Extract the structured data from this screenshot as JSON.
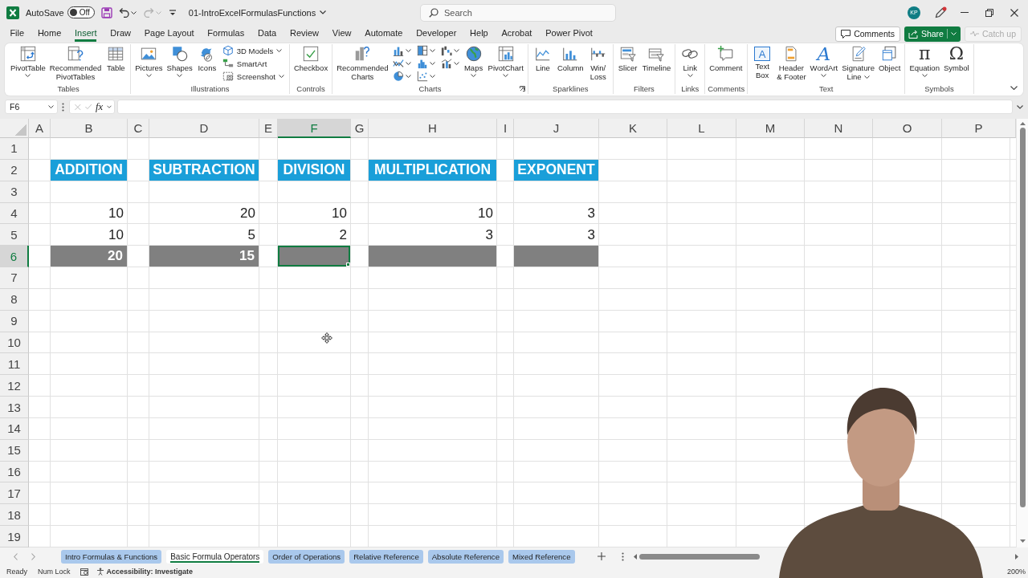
{
  "title_bar": {
    "autosave": {
      "label": "AutoSave",
      "state_text": "Off",
      "on": false
    },
    "undo": {
      "disabled": false
    },
    "redo": {
      "disabled": true
    },
    "filename": "01-IntroExcelFormulasFunctions",
    "search": {
      "placeholder": "Search"
    },
    "account_initials": "KP"
  },
  "ribbon_tabs": [
    {
      "label": "File",
      "selected": false
    },
    {
      "label": "Home",
      "selected": false
    },
    {
      "label": "Insert",
      "selected": true
    },
    {
      "label": "Draw",
      "selected": false
    },
    {
      "label": "Page Layout",
      "selected": false
    },
    {
      "label": "Formulas",
      "selected": false
    },
    {
      "label": "Data",
      "selected": false
    },
    {
      "label": "Review",
      "selected": false
    },
    {
      "label": "View",
      "selected": false
    },
    {
      "label": "Automate",
      "selected": false
    },
    {
      "label": "Developer",
      "selected": false
    },
    {
      "label": "Help",
      "selected": false
    },
    {
      "label": "Acrobat",
      "selected": false
    },
    {
      "label": "Power Pivot",
      "selected": false
    }
  ],
  "ribbon_buttons": {
    "comments": "Comments",
    "share": "Share",
    "catch_up": {
      "label": "Catch up",
      "disabled": true
    }
  },
  "ribbon_groups": [
    {
      "name": "Tables",
      "launcher": false,
      "items": [
        {
          "kind": "large",
          "label": "PivotTable",
          "dropdown": true
        },
        {
          "kind": "large",
          "label": "Recommended\nPivotTables",
          "dropdown": false
        },
        {
          "kind": "large",
          "label": "Table",
          "dropdown": false
        }
      ]
    },
    {
      "name": "Illustrations",
      "launcher": false,
      "items": [
        {
          "kind": "large",
          "label": "Pictures",
          "dropdown": true
        },
        {
          "kind": "large",
          "label": "Shapes",
          "dropdown": true
        },
        {
          "kind": "large",
          "label": "Icons",
          "dropdown": false
        },
        {
          "kind": "small",
          "label": "3D Models",
          "dropdown": true
        },
        {
          "kind": "small",
          "label": "SmartArt",
          "dropdown": false
        },
        {
          "kind": "small",
          "label": "Screenshot",
          "dropdown": true
        }
      ]
    },
    {
      "name": "Controls",
      "launcher": false,
      "items": [
        {
          "kind": "large",
          "label": "Checkbox",
          "dropdown": false
        }
      ]
    },
    {
      "name": "Charts",
      "launcher": true,
      "items": [
        {
          "kind": "large",
          "label": "Recommended\nCharts",
          "dropdown": false
        },
        {
          "kind": "icon",
          "dropdown": true
        },
        {
          "kind": "icon",
          "dropdown": true
        },
        {
          "kind": "icon",
          "dropdown": true
        },
        {
          "kind": "icon",
          "dropdown": true
        },
        {
          "kind": "icon",
          "dropdown": true
        },
        {
          "kind": "icon",
          "dropdown": true
        },
        {
          "kind": "icon",
          "dropdown": true
        },
        {
          "kind": "icon",
          "dropdown": true
        },
        {
          "kind": "large",
          "label": "Maps",
          "dropdown": true
        },
        {
          "kind": "large",
          "label": "PivotChart",
          "dropdown": true
        }
      ]
    },
    {
      "name": "Sparklines",
      "launcher": false,
      "items": [
        {
          "kind": "large",
          "label": "Line",
          "dropdown": false
        },
        {
          "kind": "large",
          "label": "Column",
          "dropdown": false
        },
        {
          "kind": "large",
          "label": "Win/\nLoss",
          "dropdown": false
        }
      ]
    },
    {
      "name": "Filters",
      "launcher": false,
      "items": [
        {
          "kind": "large",
          "label": "Slicer",
          "dropdown": false
        },
        {
          "kind": "large",
          "label": "Timeline",
          "dropdown": false
        }
      ]
    },
    {
      "name": "Links",
      "launcher": false,
      "items": [
        {
          "kind": "large",
          "label": "Link",
          "dropdown": true
        }
      ]
    },
    {
      "name": "Comments",
      "launcher": false,
      "items": [
        {
          "kind": "large",
          "label": "Comment",
          "dropdown": false
        }
      ]
    },
    {
      "name": "Text",
      "launcher": false,
      "items": [
        {
          "kind": "large",
          "glyph": "A",
          "label": "Text\nBox",
          "dropdown": false
        },
        {
          "kind": "large",
          "label": "Header\n& Footer",
          "dropdown": false
        },
        {
          "kind": "large",
          "glyph": "A",
          "label": "WordArt",
          "dropdown": true
        },
        {
          "kind": "large",
          "label": "Signature\nLine",
          "dropdown": true
        },
        {
          "kind": "large",
          "label": "Object",
          "dropdown": false
        }
      ]
    },
    {
      "name": "Symbols",
      "launcher": false,
      "items": [
        {
          "kind": "large",
          "glyph": "π",
          "label": "Equation",
          "dropdown": true
        },
        {
          "kind": "large",
          "glyph": "Ω",
          "label": "Symbol",
          "dropdown": false
        }
      ]
    }
  ],
  "formula_bar": {
    "name_box": "F6",
    "function_button": "fx"
  },
  "sheet": {
    "columns": [
      {
        "letter": "A",
        "selected": false
      },
      {
        "letter": "B",
        "selected": false
      },
      {
        "letter": "C",
        "selected": false
      },
      {
        "letter": "D",
        "selected": false
      },
      {
        "letter": "E",
        "selected": false
      },
      {
        "letter": "F",
        "selected": true
      },
      {
        "letter": "G",
        "selected": false
      },
      {
        "letter": "H",
        "selected": false
      },
      {
        "letter": "I",
        "selected": false
      },
      {
        "letter": "J",
        "selected": false
      },
      {
        "letter": "K",
        "selected": false
      },
      {
        "letter": "L",
        "selected": false
      },
      {
        "letter": "M",
        "selected": false
      },
      {
        "letter": "N",
        "selected": false
      },
      {
        "letter": "O",
        "selected": false
      },
      {
        "letter": "P",
        "selected": false
      }
    ],
    "rows": [
      {
        "number": "1",
        "selected": false
      },
      {
        "number": "2",
        "selected": false
      },
      {
        "number": "3",
        "selected": false
      },
      {
        "number": "4",
        "selected": false
      },
      {
        "number": "5",
        "selected": false
      },
      {
        "number": "6",
        "selected": true
      },
      {
        "number": "7",
        "selected": false
      },
      {
        "number": "8",
        "selected": false
      },
      {
        "number": "9",
        "selected": false
      },
      {
        "number": "10",
        "selected": false
      },
      {
        "number": "11",
        "selected": false
      },
      {
        "number": "12",
        "selected": false
      },
      {
        "number": "13",
        "selected": false
      },
      {
        "number": "14",
        "selected": false
      },
      {
        "number": "15",
        "selected": false
      },
      {
        "number": "16",
        "selected": false
      },
      {
        "number": "17",
        "selected": false
      },
      {
        "number": "18",
        "selected": false
      },
      {
        "number": "19",
        "selected": false
      }
    ],
    "operations": [
      {
        "heading": {
          "text": "ADDITION",
          "selected": false
        },
        "values": [
          {
            "text": "10",
            "selected": false
          },
          {
            "text": "10",
            "selected": false
          }
        ],
        "result": {
          "text": "20",
          "selected": false
        }
      },
      {
        "heading": {
          "text": "SUBTRACTION",
          "selected": false
        },
        "values": [
          {
            "text": "20",
            "selected": false
          },
          {
            "text": "5",
            "selected": false
          }
        ],
        "result": {
          "text": "15",
          "selected": false
        }
      },
      {
        "heading": {
          "text": "DIVISION",
          "selected": false
        },
        "values": [
          {
            "text": "10",
            "selected": false
          },
          {
            "text": "2",
            "selected": false
          }
        ],
        "result": {
          "selected": true
        }
      },
      {
        "heading": {
          "text": "MULTIPLICATION",
          "selected": false
        },
        "values": [
          {
            "text": "10",
            "selected": false
          },
          {
            "text": "3",
            "selected": false
          }
        ],
        "result": {
          "selected": false
        }
      },
      {
        "heading": {
          "text": "EXPONENT",
          "selected": false
        },
        "values": [
          {
            "text": "3",
            "selected": false
          },
          {
            "text": "3",
            "selected": false
          }
        ],
        "result": {
          "selected": false
        }
      }
    ]
  },
  "sheet_tabs": [
    {
      "label": "Intro Formulas & Functions",
      "selected": false
    },
    {
      "label": "Basic Formula Operators",
      "selected": true
    },
    {
      "label": "Order of Operations",
      "selected": false
    },
    {
      "label": "Relative Reference",
      "selected": false
    },
    {
      "label": "Absolute Reference",
      "selected": false
    },
    {
      "label": "Mixed Reference",
      "selected": false
    }
  ],
  "status_bar": {
    "mode": "Ready",
    "num_lock": "Num Lock",
    "accessibility": "Accessibility: Investigate",
    "zoom": "200%"
  }
}
